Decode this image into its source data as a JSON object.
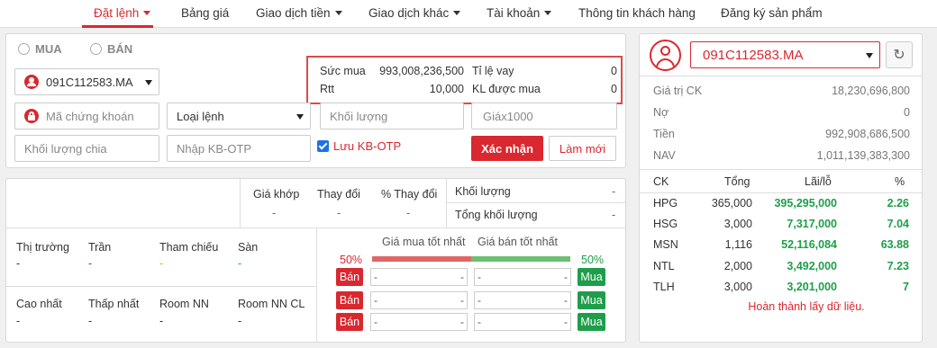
{
  "nav": {
    "items": [
      {
        "label": "Đặt lệnh",
        "active": true,
        "dropdown": true
      },
      {
        "label": "Bảng giá",
        "active": false,
        "dropdown": false
      },
      {
        "label": "Giao dịch tiền",
        "active": false,
        "dropdown": true
      },
      {
        "label": "Giao dịch khác",
        "active": false,
        "dropdown": true
      },
      {
        "label": "Tài khoản",
        "active": false,
        "dropdown": true
      },
      {
        "label": "Thông tin khách hàng",
        "active": false,
        "dropdown": false
      },
      {
        "label": "Đăng ký sản phẩm",
        "active": false,
        "dropdown": false
      }
    ]
  },
  "order": {
    "side_buy": "MUA",
    "side_sell": "BÁN",
    "account_value": "091C112583.MA",
    "symbol_placeholder": "Mã chứng khoán",
    "order_type_placeholder": "Loại lệnh",
    "quantity_placeholder": "Khối lượng",
    "price_placeholder": "Giáx1000",
    "split_quantity_placeholder": "Khối lượng chia",
    "otp_placeholder": "Nhập KB-OTP",
    "save_otp_label": "Lưu KB-OTP",
    "save_otp_checked": true,
    "confirm_label": "Xác nhận",
    "reset_label": "Làm mới",
    "buying_power_label": "Sức mua",
    "buying_power_value": "993,008,236,500",
    "loan_ratio_label": "Tỉ lệ vay",
    "loan_ratio_value": "0",
    "rtt_label": "Rtt",
    "rtt_value": "10,000",
    "max_buy_label": "KL được mua",
    "max_buy_value": "0"
  },
  "market": {
    "match_price_label": "Giá khớp",
    "change_label": "Thay đổi",
    "pct_change_label": "% Thay đổi",
    "volume_label": "Khối lượng",
    "total_volume_label": "Tổng khối lượng",
    "empty": "-",
    "market_label": "Thị trường",
    "ceiling_label": "Trần",
    "reference_label": "Tham chiếu",
    "floor_label": "Sàn",
    "high_label": "Cao nhất",
    "low_label": "Thấp nhất",
    "room_label": "Room NN",
    "room_remaining_label": "Room NN CL",
    "best_bid_label": "Giá mua tốt nhất",
    "best_ask_label": "Giá bán tốt nhất",
    "bid_ratio": "50%",
    "ask_ratio": "50%",
    "sell_button": "Bán",
    "buy_button": "Mua"
  },
  "account": {
    "selected": "091C112583.MA",
    "summary": [
      {
        "label": "Giá trị CK",
        "value": "18,230,696,800"
      },
      {
        "label": "Nợ",
        "value": "0"
      },
      {
        "label": "Tiền",
        "value": "992,908,686,500"
      },
      {
        "label": "NAV",
        "value": "1,011,139,383,300"
      }
    ],
    "columns": [
      "CK",
      "Tổng",
      "Lãi/lỗ",
      "%"
    ],
    "holdings": [
      {
        "symbol": "HPG",
        "total": "365,000",
        "pnl": "395,295,000",
        "pct": "2.26"
      },
      {
        "symbol": "HSG",
        "total": "3,000",
        "pnl": "7,317,000",
        "pct": "7.04"
      },
      {
        "symbol": "MSN",
        "total": "1,116",
        "pnl": "52,116,084",
        "pct": "63.88"
      },
      {
        "symbol": "NTL",
        "total": "2,000",
        "pnl": "3,492,000",
        "pct": "7.23"
      },
      {
        "symbol": "TLH",
        "total": "3,000",
        "pnl": "3,201,000",
        "pct": "7"
      }
    ],
    "status_message": "Hoàn thành lấy dữ liệu."
  },
  "colors": {
    "accent": "#d9282f",
    "positive": "#1e9e4a",
    "link": "#1a73e8"
  }
}
